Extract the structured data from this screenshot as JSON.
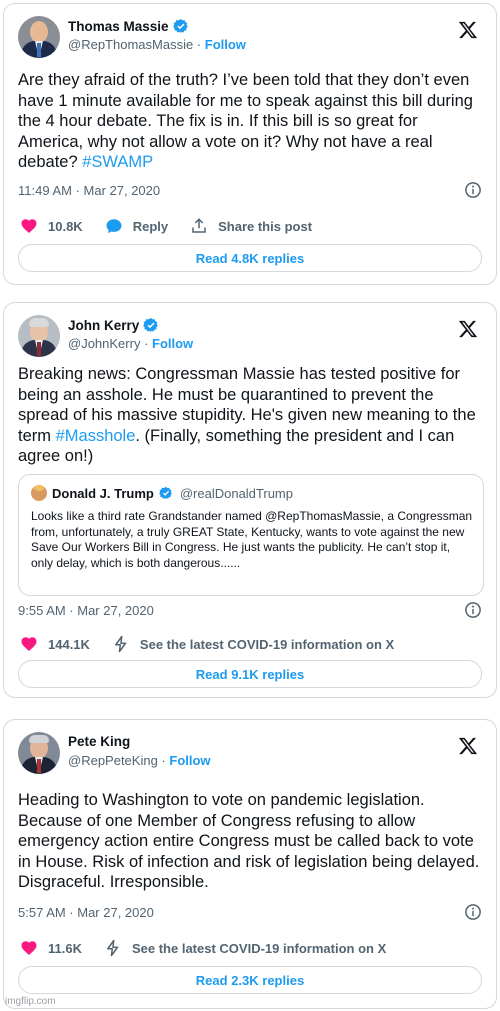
{
  "colors": {
    "accent": "#1d9bf0",
    "like": "#f91880",
    "border": "#cfd9de",
    "muted": "#536471"
  },
  "tweets": [
    {
      "name": "Thomas Massie",
      "handle": "@RepThomasMassie",
      "follow": "Follow",
      "text_plain": "Are they afraid of the truth?  I’ve been told that they don’t even have 1 minute available for me to speak against this bill during the 4 hour debate. The fix is in. If this bill is so great for America, why not allow a vote on it?  Why not have a real debate? ",
      "hashtag": "#SWAMP",
      "timestamp": "11:49 AM · Mar 27, 2020",
      "likes": "10.8K",
      "reply_label": "Reply",
      "share_label": "Share this post",
      "read_replies": "Read 4.8K replies"
    },
    {
      "name": "John Kerry",
      "handle": "@JohnKerry",
      "follow": "Follow",
      "text_before": "Breaking news: Congressman Massie has tested positive for being an asshole. He must be quarantined to prevent the spread of his massive stupidity. He's given new meaning to the term ",
      "hashtag": "#Masshole",
      "text_after": ". (Finally, something the president and I can agree on!)",
      "quote": {
        "name": "Donald J. Trump",
        "handle": "@realDonaldTrump",
        "text": "Looks like a third rate Grandstander named @RepThomasMassie, a Congressman from, unfortunately, a truly GREAT State, Kentucky, wants to vote against the new Save Our Workers Bill in Congress. He just wants the publicity. He can’t stop it, only delay, which is both dangerous......"
      },
      "timestamp": "9:55 AM · Mar 27, 2020",
      "likes": "144.1K",
      "covid_label": "See the latest COVID-19 information on X",
      "read_replies": "Read 9.1K replies"
    },
    {
      "name": "Pete King",
      "handle": "@RepPeteKing",
      "follow": "Follow",
      "text": "Heading to Washington to vote on pandemic legislation. Because of one Member of Congress refusing to allow emergency action entire Congress must be called back to vote in House. Risk of infection and risk of legislation being delayed. Disgraceful. Irresponsible.",
      "timestamp": "5:57 AM · Mar 27, 2020",
      "likes": "11.6K",
      "covid_label": "See the latest COVID-19 information on X",
      "read_replies": "Read 2.3K replies"
    }
  ],
  "watermark": "imgflip.com",
  "icons": [
    "verified-badge-icon",
    "x-logo-icon",
    "info-icon",
    "heart-icon",
    "reply-icon",
    "share-icon",
    "lightning-icon"
  ]
}
